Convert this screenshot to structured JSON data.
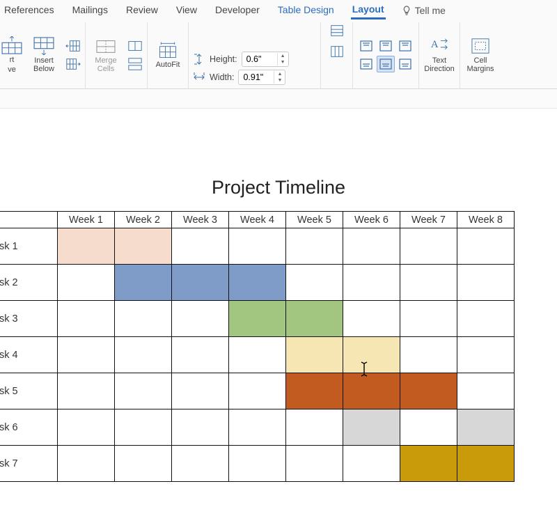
{
  "ribbon": {
    "tabs": [
      "References",
      "Mailings",
      "Review",
      "View",
      "Developer",
      "Table Design",
      "Layout"
    ],
    "active_tab": "Layout",
    "tell_me": "Tell me",
    "groups": {
      "rows_cols": {
        "insert_above_short": "rt",
        "insert_above_short2": "ve",
        "insert_below": "Insert\nBelow"
      },
      "merge": {
        "label": "Merge\nCells"
      },
      "autofit": {
        "label": "AutoFit"
      },
      "size": {
        "height_label": "Height:",
        "height_value": "0.6\"",
        "width_label": "Width:",
        "width_value": "0.91\""
      },
      "text_dir": {
        "label": "Text\nDirection"
      },
      "cell_margins": {
        "label": "Cell\nMargins"
      }
    }
  },
  "document": {
    "title": "Project Timeline",
    "weeks": [
      "Week 1",
      "Week 2",
      "Week 3",
      "Week 4",
      "Week 5",
      "Week 6",
      "Week 7",
      "Week 8"
    ],
    "tasks": [
      {
        "name": "sk 1",
        "cells": [
          "#f6dccd",
          "#f6dccd",
          "",
          "",
          "",
          "",
          "",
          ""
        ]
      },
      {
        "name": "sk 2",
        "cells": [
          "",
          "#7f9cc9",
          "#7f9cc9",
          "#7f9cc9",
          "",
          "",
          "",
          ""
        ]
      },
      {
        "name": "sk 3",
        "cells": [
          "",
          "",
          "",
          "#a2c580",
          "#a2c580",
          "",
          "",
          ""
        ]
      },
      {
        "name": "sk 4",
        "cells": [
          "",
          "",
          "",
          "",
          "#f6e6b3",
          "#f6e6b3",
          "",
          ""
        ]
      },
      {
        "name": "sk 5",
        "cells": [
          "",
          "",
          "",
          "",
          "#c25b1f",
          "#c25b1f",
          "#c25b1f",
          ""
        ]
      },
      {
        "name": "sk 6",
        "cells": [
          "",
          "",
          "",
          "",
          "",
          "#d7d7d7",
          "",
          "#d7d7d7"
        ]
      },
      {
        "name": "sk 7",
        "cells": [
          "",
          "",
          "",
          "",
          "",
          "",
          "#c99a0a",
          "#c99a0a"
        ]
      }
    ]
  }
}
